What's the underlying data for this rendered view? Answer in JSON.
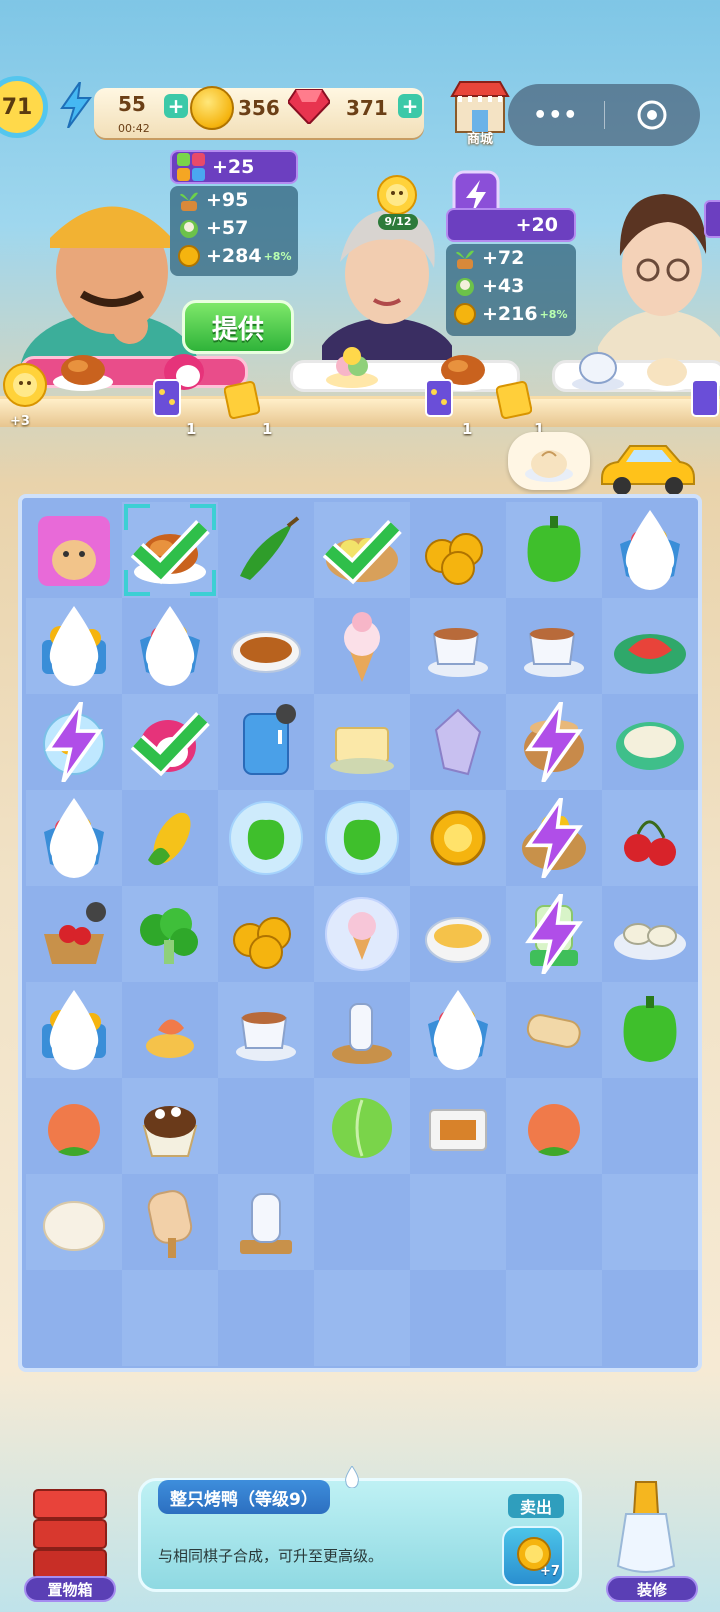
{
  "top_bar": {
    "player_level": "71",
    "energy": "55",
    "energy_timer": "00:42",
    "coins": "356",
    "gems": "371",
    "shop_label": "商城",
    "menu_dots": "•••"
  },
  "customers": [
    {
      "requirement_bonus": "+25",
      "reward_a": "+95",
      "reward_b": "+57",
      "reward_coins": "+284",
      "bonus_pct": "+8%"
    },
    {
      "badge": "9/12",
      "requirement_bonus": "+20",
      "reward_a": "+72",
      "reward_b": "+43",
      "reward_coins": "+216",
      "bonus_pct": "+8%"
    }
  ],
  "provide_button": "提供",
  "sun_badge": "+3",
  "shelf_counts": [
    "1",
    "1",
    "1",
    "1"
  ],
  "board": {
    "rows": [
      [
        "hamster-crate",
        "roast-duck",
        "green-chili",
        "dumpling-basket",
        "coin-pile",
        "green-pepper",
        "gift-bag"
      ],
      [
        "treasure-chest",
        "gift-bag",
        "curry-bowl",
        "ice-cream-cone",
        "tea-cup",
        "tea-cup",
        "lobster-plate"
      ],
      [
        "fish-bowl",
        "dragon-fruit",
        "fridge",
        "tofu",
        "crystal",
        "clay-pot",
        "oyster-soup"
      ],
      [
        "gift-bag",
        "corn",
        "pepper-bubble",
        "pepper-bubble",
        "coin",
        "corn-basket",
        "cherries"
      ],
      [
        "cherry-basket",
        "broccoli",
        "coin-pile",
        "ice-cream-bubble",
        "egg-soup",
        "juicer",
        "oyster-plate"
      ],
      [
        "treasure-chest",
        "shrimp-dish",
        "tea-cup",
        "sake-set",
        "gift-bag",
        "burrito",
        "green-pepper"
      ],
      [
        "peach",
        "ice-cream-cup",
        "empty",
        "cabbage",
        "takeout-box",
        "peach",
        "empty"
      ],
      [
        "steamed-bun",
        "popsicle",
        "sake-bottle",
        "empty",
        "empty",
        "empty",
        "empty"
      ],
      [
        "empty",
        "empty",
        "empty",
        "empty",
        "empty",
        "empty",
        "empty"
      ]
    ]
  },
  "selected_item": {
    "title": "整只烤鸭（等级9）",
    "description": "与相同棋子合成，可升至更高级。",
    "sell_label": "卖出",
    "sell_amount": "+7"
  },
  "bottom_left_label": "置物箱",
  "bottom_right_label": "装修"
}
